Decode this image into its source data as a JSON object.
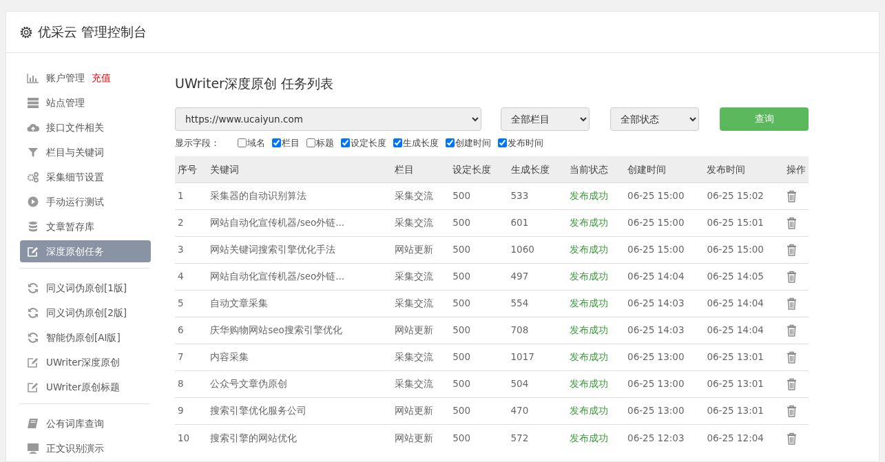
{
  "header": {
    "title": "优采云 管理控制台"
  },
  "sidebar": {
    "groups": [
      {
        "items": [
          {
            "label": "账户管理",
            "badge": "充值",
            "selected": false
          },
          {
            "label": "站点管理",
            "selected": false
          },
          {
            "label": "接口文件相关",
            "selected": false
          },
          {
            "label": "栏目与关键词",
            "selected": false
          },
          {
            "label": "采集细节设置",
            "selected": false
          },
          {
            "label": "手动运行测试",
            "selected": false
          },
          {
            "label": "文章暂存库",
            "selected": false
          },
          {
            "label": "深度原创任务",
            "selected": true
          }
        ]
      },
      {
        "items": [
          {
            "label": "同义词伪原创[1版]",
            "selected": false
          },
          {
            "label": "同义词伪原创[2版]",
            "selected": false
          },
          {
            "label": "智能伪原创[AI版]",
            "selected": false
          },
          {
            "label": "UWriter深度原创",
            "selected": false
          },
          {
            "label": "UWriter原创标题",
            "selected": false
          }
        ]
      },
      {
        "items": [
          {
            "label": "公有词库查询",
            "selected": false
          },
          {
            "label": "正文识别演示",
            "selected": false
          }
        ]
      }
    ]
  },
  "main": {
    "title": "UWriter深度原创 任务列表",
    "filters": {
      "site": "https://www.ucaiyun.com",
      "column": "全部栏目",
      "status": "全部状态",
      "button": "查询"
    },
    "fields_label": "显示字段：",
    "fields": [
      {
        "label": "域名",
        "checked": false
      },
      {
        "label": "栏目",
        "checked": true
      },
      {
        "label": "标题",
        "checked": false
      },
      {
        "label": "设定长度",
        "checked": true
      },
      {
        "label": "生成长度",
        "checked": true
      },
      {
        "label": "创建时间",
        "checked": true
      },
      {
        "label": "发布时间",
        "checked": true
      }
    ],
    "table": {
      "columns": [
        "序号",
        "关键词",
        "栏目",
        "设定长度",
        "生成长度",
        "当前状态",
        "创建时间",
        "发布时间",
        "操作"
      ],
      "rows": [
        [
          "1",
          "采集器的自动识别算法",
          "采集交流",
          "500",
          "533",
          "发布成功",
          "06-25 15:00",
          "06-25 15:02"
        ],
        [
          "2",
          "网站自动化宣传机器/seo外链...",
          "采集交流",
          "500",
          "601",
          "发布成功",
          "06-25 15:00",
          "06-25 15:01"
        ],
        [
          "3",
          "网站关键词搜索引擎优化手法",
          "网站更新",
          "500",
          "1060",
          "发布成功",
          "06-25 15:00",
          "06-25 15:00"
        ],
        [
          "4",
          "网站自动化宣传机器/seo外链...",
          "采集交流",
          "500",
          "497",
          "发布成功",
          "06-25 14:04",
          "06-25 14:05"
        ],
        [
          "5",
          "自动文章采集",
          "采集交流",
          "500",
          "554",
          "发布成功",
          "06-25 14:03",
          "06-25 14:04"
        ],
        [
          "6",
          "庆华购物网站seo搜索引擎优化",
          "网站更新",
          "500",
          "708",
          "发布成功",
          "06-25 14:03",
          "06-25 14:04"
        ],
        [
          "7",
          "内容采集",
          "采集交流",
          "500",
          "1017",
          "发布成功",
          "06-25 13:00",
          "06-25 13:01"
        ],
        [
          "8",
          "公众号文章伪原创",
          "采集交流",
          "500",
          "504",
          "发布成功",
          "06-25 13:00",
          "06-25 13:01"
        ],
        [
          "9",
          "搜索引擎优化服务公司",
          "网站更新",
          "500",
          "470",
          "发布成功",
          "06-25 13:00",
          "06-25 13:01"
        ],
        [
          "10",
          "搜索引擎的网站优化",
          "网站更新",
          "500",
          "572",
          "发布成功",
          "06-25 12:03",
          "06-25 12:04"
        ]
      ]
    }
  }
}
